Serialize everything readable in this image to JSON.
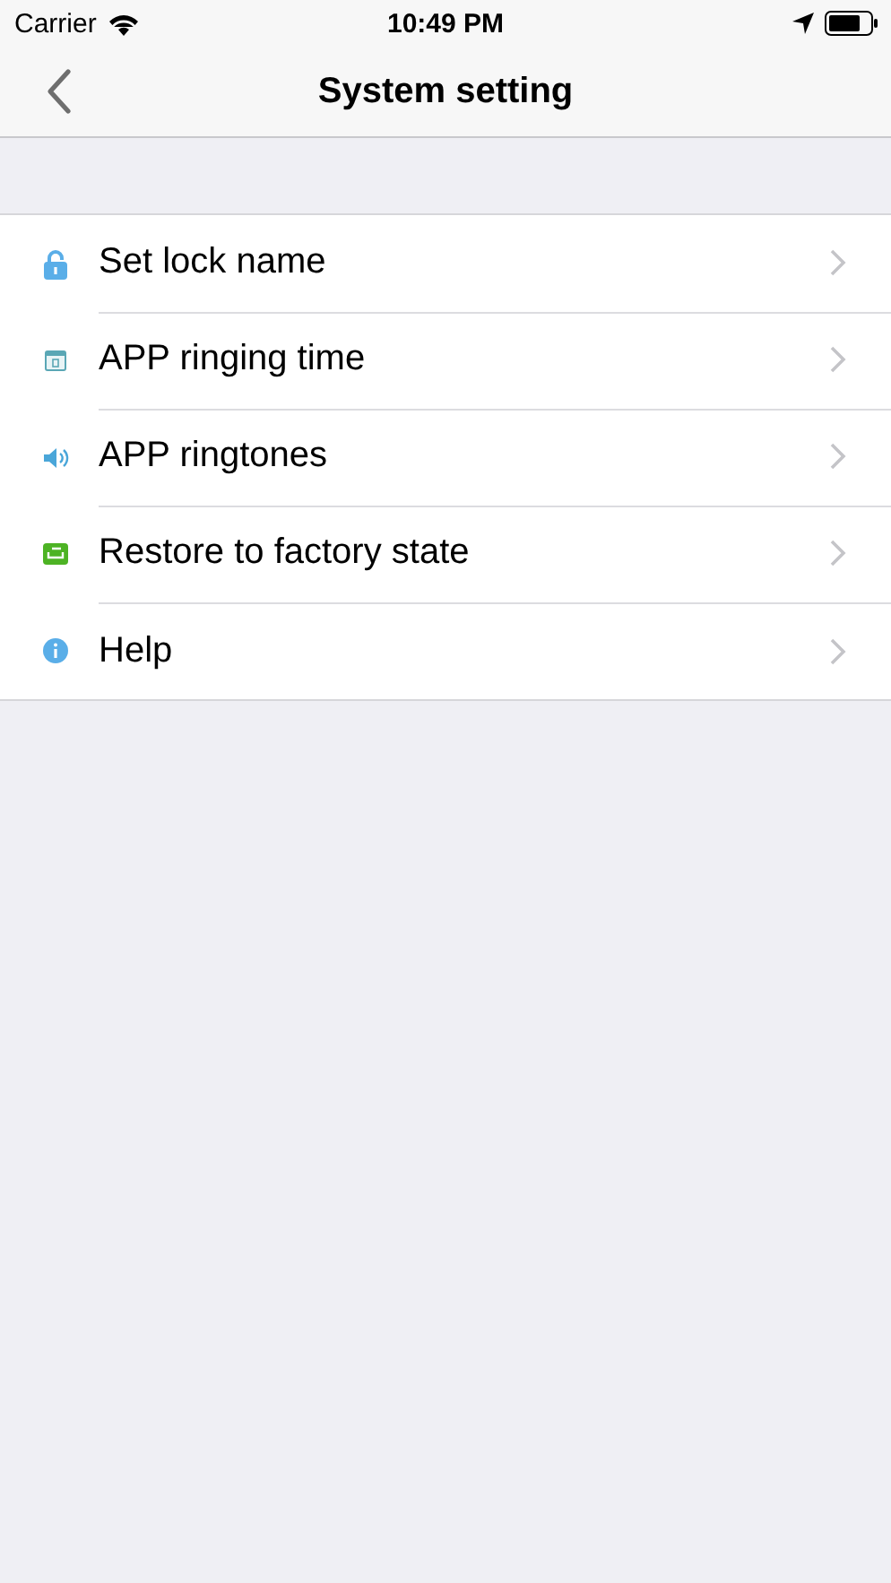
{
  "status_bar": {
    "carrier": "Carrier",
    "time": "10:49 PM"
  },
  "nav": {
    "title": "System setting"
  },
  "items": [
    {
      "kind": "lock",
      "label": "Set lock name"
    },
    {
      "kind": "calendar",
      "label": "APP ringing time"
    },
    {
      "kind": "sound",
      "label": "APP ringtones"
    },
    {
      "kind": "restore",
      "label": "Restore to factory state"
    },
    {
      "kind": "info",
      "label": "Help"
    }
  ]
}
